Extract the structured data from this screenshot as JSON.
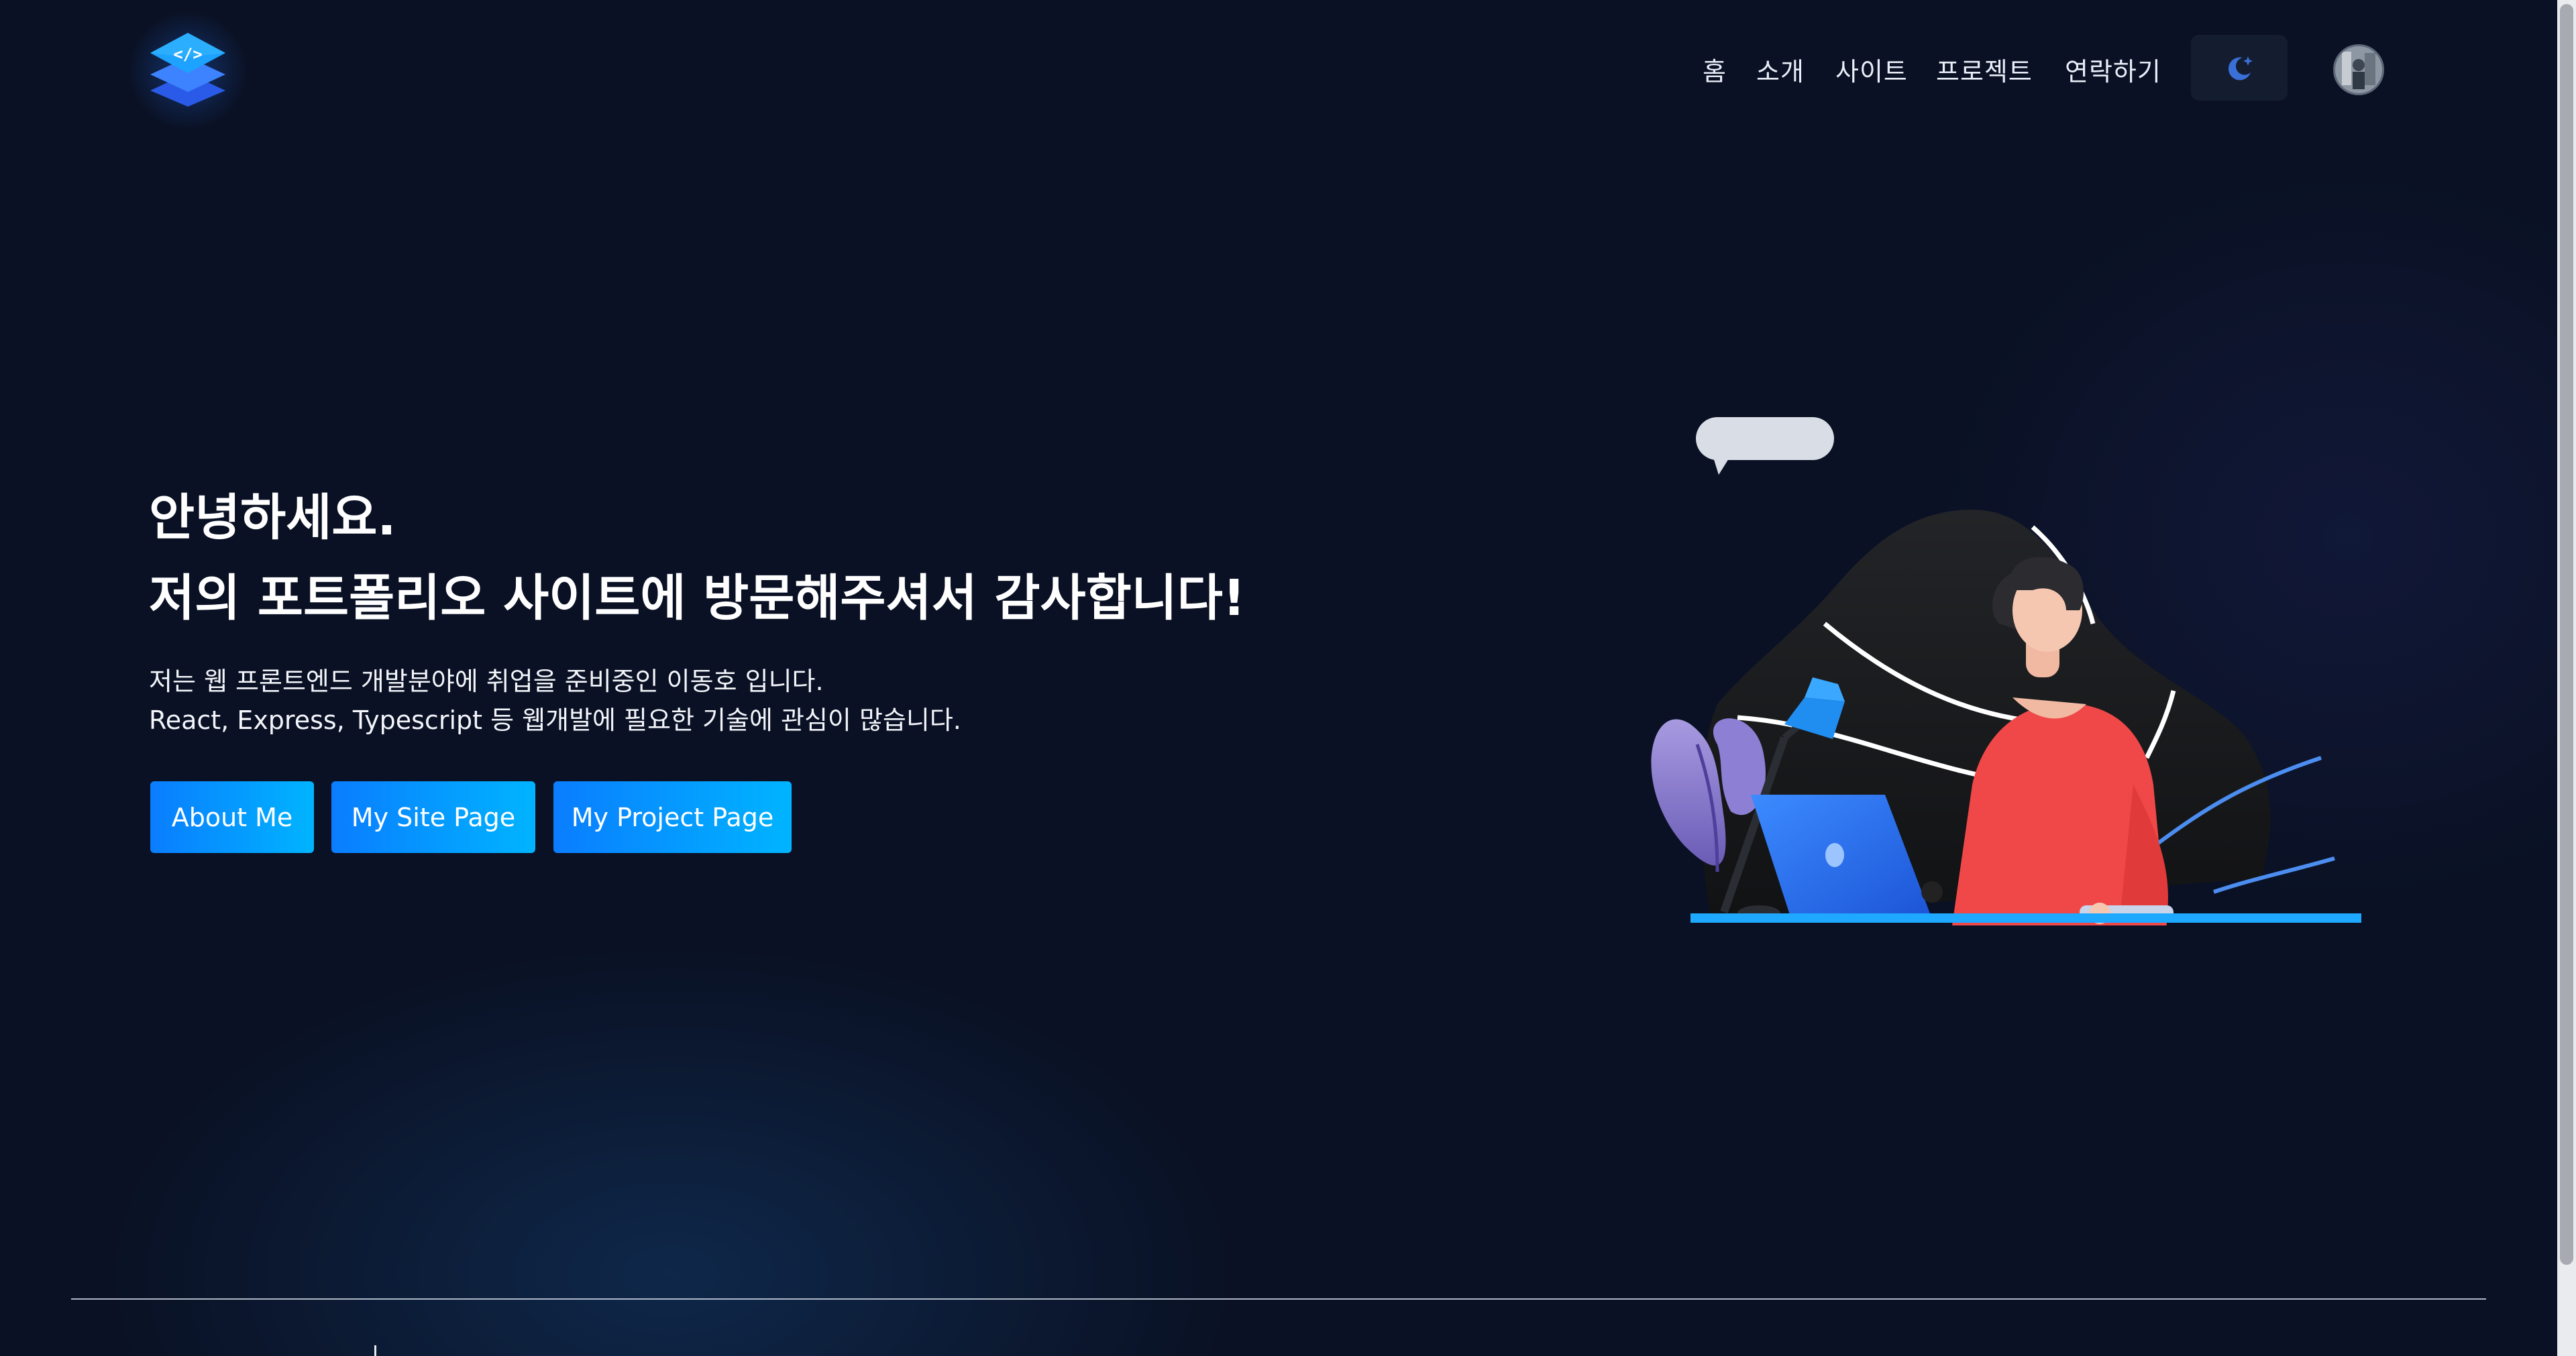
{
  "header": {
    "logo_icon": "code-layers-icon",
    "nav": [
      {
        "label": "홈"
      },
      {
        "label": "소개"
      },
      {
        "label": "사이트"
      },
      {
        "label": "프로젝트"
      },
      {
        "label": "연락하기"
      }
    ],
    "theme_toggle_icon": "moon-star-icon",
    "avatar_icon": "user-avatar"
  },
  "hero": {
    "title_line1": "안녕하세요.",
    "title_line2": "저의 포트폴리오 사이트에 방문해주셔서 감사합니다!",
    "desc_line1": "저는 웹 프론트엔드 개발분야에 취업을 준비중인 이동호 입니다.",
    "desc_line2": "React, Express, Typescript 등 웹개발에 필요한 기술에 관심이 많습니다.",
    "buttons": [
      {
        "label": "About Me"
      },
      {
        "label": "My Site Page"
      },
      {
        "label": "My Project Page"
      }
    ],
    "illustration": "developer-at-laptop-illustration"
  },
  "colors": {
    "background": "#0a1124",
    "button_gradient_start": "#0a7dff",
    "button_gradient_end": "#00b4ff",
    "accent_red_shirt": "#f04848"
  }
}
